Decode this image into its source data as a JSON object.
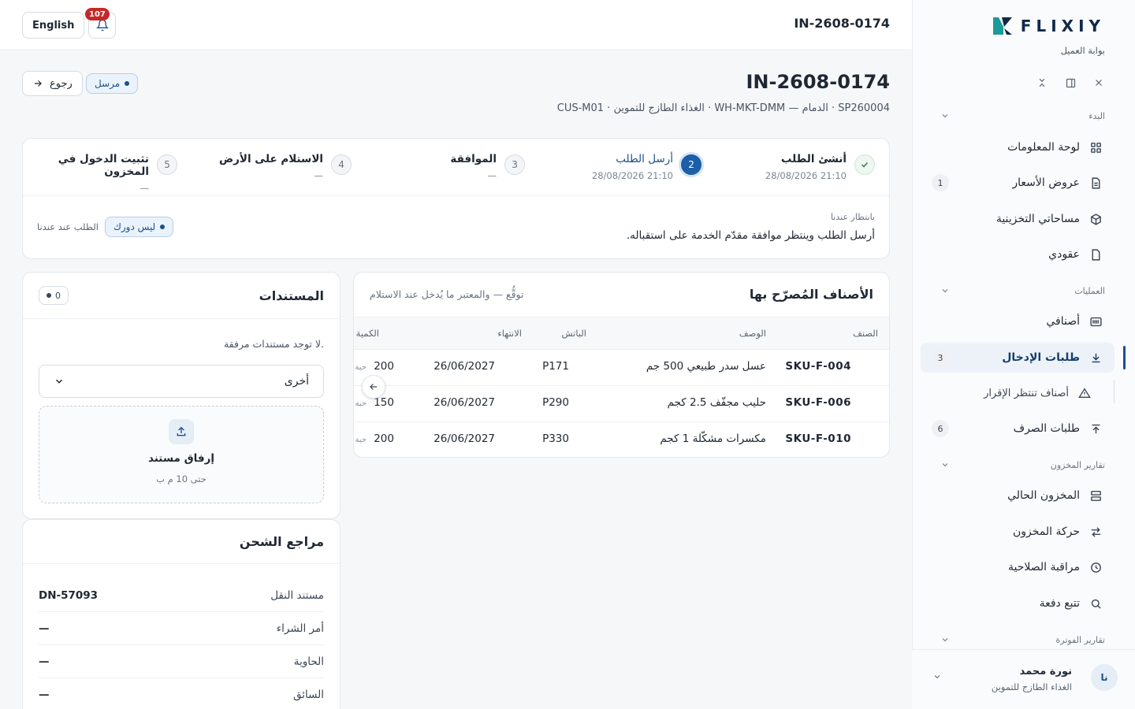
{
  "brand": {
    "name": "FLIXIY",
    "subtitle": "بوابة العميل"
  },
  "topbar": {
    "ref": "IN-2608-0174",
    "language": "English",
    "notifications": "107"
  },
  "header": {
    "title": "IN-2608-0174",
    "subtitle": "SP260004 · الدمام — WH-MKT-DMM · الغذاء الطازج للتموين · CUS-M01",
    "status": "مرسل",
    "back": "رجوع"
  },
  "steps": [
    {
      "num": "1",
      "label": "أنشئ الطلب",
      "date": "28/08/2026 21:10",
      "state": "done"
    },
    {
      "num": "2",
      "label": "أرسل الطلب",
      "date": "28/08/2026 21:10",
      "state": "current"
    },
    {
      "num": "3",
      "label": "الموافقة",
      "date": "—",
      "state": "pending"
    },
    {
      "num": "4",
      "label": "الاستلام على الأرض",
      "date": "—",
      "state": "pending"
    },
    {
      "num": "5",
      "label": "تثبيت الدخول في المخزون",
      "date": "—",
      "state": "pending"
    }
  ],
  "waiting": {
    "label": "بانتظار عندنا",
    "text": "أرسل الطلب وينتظر موافقة مقدّم الخدمة على استقباله.",
    "with_label": "الطلب عند عندنا",
    "with_value": "ليس دورك"
  },
  "items": {
    "title": "الأصناف المُصرّح بها",
    "hint": "توقُّع — والمعتبر ما يُدخل عند الاستلام",
    "columns": {
      "sku": "الصنف",
      "desc": "الوصف",
      "batch": "الباتش",
      "expiry": "الانتهاء",
      "qty": "الكمية"
    },
    "rows": [
      {
        "sku": "SKU-F-004",
        "desc": "عسل سدر طبيعي 500 جم",
        "batch": "P171",
        "expiry": "26/06/2027",
        "qty": "200",
        "unit": "حبة"
      },
      {
        "sku": "SKU-F-006",
        "desc": "حليب مجفّف 2.5 كجم",
        "batch": "P290",
        "expiry": "26/06/2027",
        "qty": "150",
        "unit": "حبة"
      },
      {
        "sku": "SKU-F-010",
        "desc": "مكسرات مشكّلة 1 كجم",
        "batch": "P330",
        "expiry": "26/06/2027",
        "qty": "200",
        "unit": "حبة"
      }
    ]
  },
  "documents": {
    "title": "المستندات",
    "count": "0",
    "empty": "لا توجد مستندات مرفقة.",
    "type_selected": "أخرى",
    "attach": "إرفاق مستند",
    "limit": "حتى 10 م ب"
  },
  "shipping": {
    "title": "مراجع الشحن",
    "rows": [
      {
        "key": "مستند النقل",
        "value": "DN-57093"
      },
      {
        "key": "أمر الشراء",
        "value": "—"
      },
      {
        "key": "الحاوية",
        "value": "—"
      },
      {
        "key": "السائق",
        "value": "—"
      }
    ]
  },
  "sidebar": {
    "sections": {
      "start": "البدء",
      "ops": "العمليات",
      "inv_reports": "تقارير المخزون",
      "billing": "تقارير الفوترة"
    },
    "items": [
      {
        "label": "لوحة المعلومات",
        "icon": "grid-icon",
        "count": ""
      },
      {
        "label": "عروض الأسعار",
        "icon": "document-icon",
        "count": "1"
      },
      {
        "label": "مساحاتي التخزينية",
        "icon": "box-icon",
        "count": ""
      },
      {
        "label": "عقودي",
        "icon": "file-icon",
        "count": ""
      },
      {
        "label": "أصنافي",
        "icon": "barcode-icon",
        "count": ""
      },
      {
        "label": "طلبات الإدخال",
        "icon": "download-icon",
        "count": "3"
      },
      {
        "label": "أصناف تنتظر الإقرار",
        "icon": "warning-icon",
        "count": ""
      },
      {
        "label": "طلبات الصرف",
        "icon": "upload-icon",
        "count": "6"
      },
      {
        "label": "المخزون الحالي",
        "icon": "stack-icon",
        "count": ""
      },
      {
        "label": "حركة المخزون",
        "icon": "swap-icon",
        "count": ""
      },
      {
        "label": "مراقبة الصلاحية",
        "icon": "clock-icon",
        "count": ""
      },
      {
        "label": "تتبع دفعة",
        "icon": "search-icon",
        "count": ""
      }
    ]
  },
  "user": {
    "initials": "نا",
    "name": "نورة محمد",
    "org": "الغذاء الطازج للتموين"
  }
}
